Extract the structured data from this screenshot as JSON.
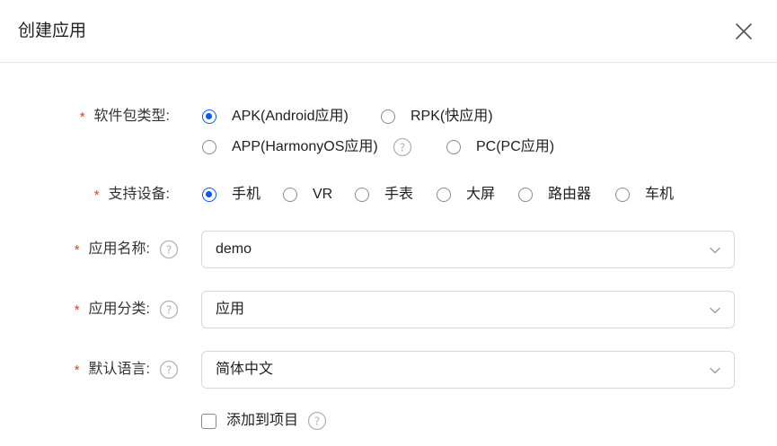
{
  "dialog": {
    "title": "创建应用"
  },
  "form": {
    "required_mark": "*",
    "package_type": {
      "label": "软件包类型:",
      "options": [
        {
          "label": "APK(Android应用)",
          "checked": true
        },
        {
          "label": "RPK(快应用)",
          "checked": false
        },
        {
          "label": "APP(HarmonyOS应用)",
          "checked": false
        },
        {
          "label": "PC(PC应用)",
          "checked": false
        }
      ]
    },
    "device": {
      "label": "支持设备:",
      "options": [
        {
          "label": "手机",
          "checked": true
        },
        {
          "label": "VR",
          "checked": false
        },
        {
          "label": "手表",
          "checked": false
        },
        {
          "label": "大屏",
          "checked": false
        },
        {
          "label": "路由器",
          "checked": false
        },
        {
          "label": "车机",
          "checked": false
        }
      ]
    },
    "app_name": {
      "label": "应用名称:",
      "value": "demo"
    },
    "app_category": {
      "label": "应用分类:",
      "value": "应用"
    },
    "default_language": {
      "label": "默认语言:",
      "value": "简体中文"
    },
    "add_to_project": {
      "label": "添加到项目",
      "checked": false
    }
  },
  "icons": {
    "close": "close-icon",
    "help": "help-circle-icon",
    "dropdown": "chevron-down-icon"
  },
  "colors": {
    "accent": "#0a59f7",
    "required": "#e84026",
    "border": "#d8d8d8"
  }
}
